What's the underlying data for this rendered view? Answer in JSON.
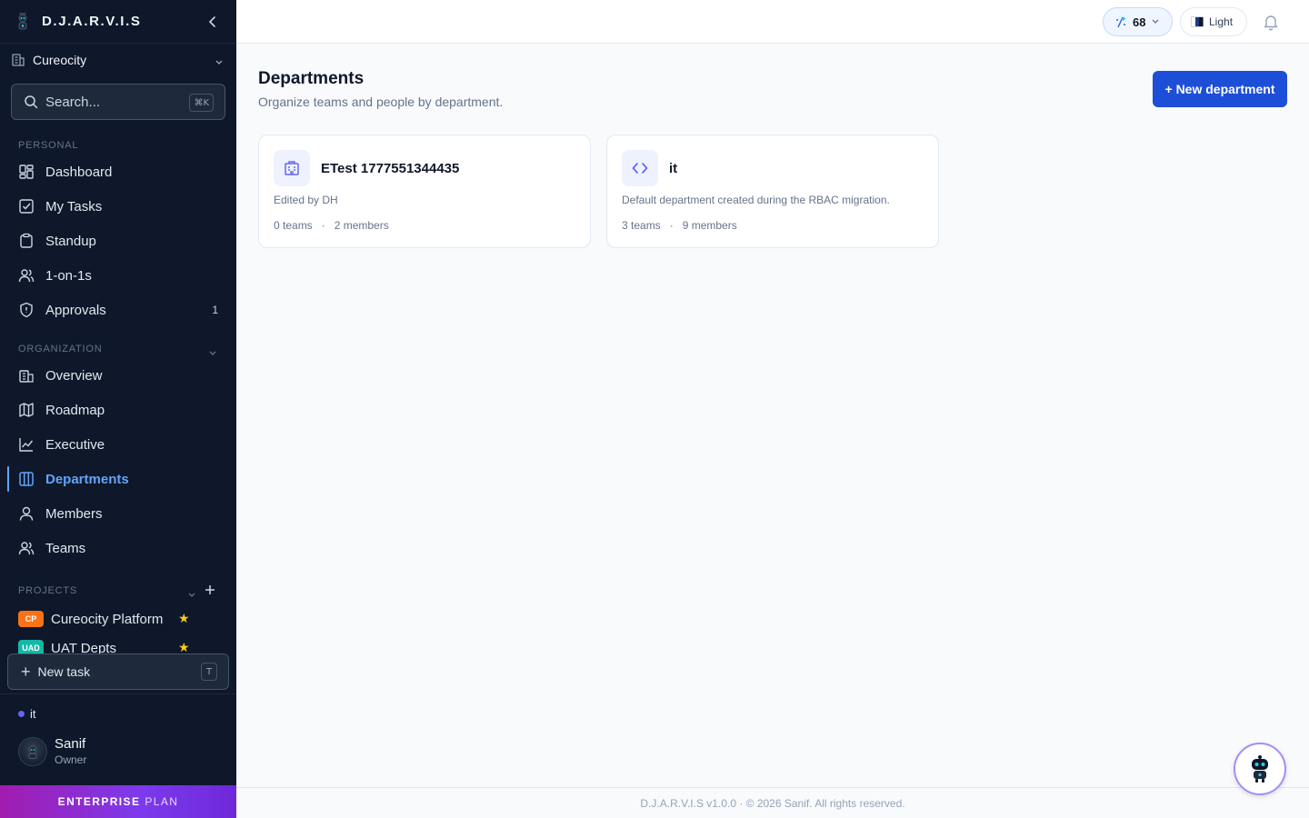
{
  "app": {
    "name": "D.J.A.R.V.I.S"
  },
  "org": {
    "name": "Cureocity"
  },
  "search": {
    "placeholder": "Search...",
    "shortcut": "⌘K"
  },
  "sidebar": {
    "personal_label": "PERSONAL",
    "personal": [
      {
        "label": "Dashboard",
        "icon": "grid-icon"
      },
      {
        "label": "My Tasks",
        "icon": "checkbox-icon"
      },
      {
        "label": "Standup",
        "icon": "clipboard-icon"
      },
      {
        "label": "1-on-1s",
        "icon": "users-icon"
      },
      {
        "label": "Approvals",
        "icon": "shield-icon",
        "badge": "1"
      }
    ],
    "organization_label": "ORGANIZATION",
    "organization": [
      {
        "label": "Overview",
        "icon": "building-icon"
      },
      {
        "label": "Roadmap",
        "icon": "map-icon"
      },
      {
        "label": "Executive",
        "icon": "chart-line-icon"
      },
      {
        "label": "Departments",
        "icon": "columns-icon",
        "active": true
      },
      {
        "label": "Members",
        "icon": "user-icon"
      },
      {
        "label": "Teams",
        "icon": "team-icon"
      }
    ],
    "projects_label": "PROJECTS",
    "projects": [
      {
        "badge": "CP",
        "name": "Cureocity Platform",
        "color": "#f97316",
        "starred": true
      },
      {
        "badge": "UAD",
        "name": "UAT Depts",
        "color": "#14b8a6",
        "starred": true
      }
    ],
    "new_task": {
      "label": "New task",
      "shortcut": "T"
    },
    "current_department": "it",
    "user": {
      "name": "Sanif",
      "role": "Owner"
    },
    "plan": {
      "word1": "ENTERPRISE",
      "word2": "PLAN"
    }
  },
  "topbar": {
    "score": "68",
    "theme_label": "Light"
  },
  "main": {
    "title": "Departments",
    "subtitle": "Organize teams and people by department.",
    "new_button": "+ New department",
    "departments": [
      {
        "name": "ETest 1777551344435",
        "description": "Edited by DH",
        "teams": "0 teams",
        "members": "2 members",
        "icon": "building-icon"
      },
      {
        "name": "it",
        "description": "Default department created during the RBAC migration.",
        "teams": "3 teams",
        "members": "9 members",
        "icon": "code-icon"
      }
    ],
    "separator": "·"
  },
  "footer": {
    "text": "D.J.A.R.V.I.S v1.0.0 · © 2026 Sanif. All rights reserved."
  },
  "colors": {
    "sidebar_bg": "#0f172a",
    "accent": "#1d4ed8",
    "active": "#60a5fa"
  }
}
